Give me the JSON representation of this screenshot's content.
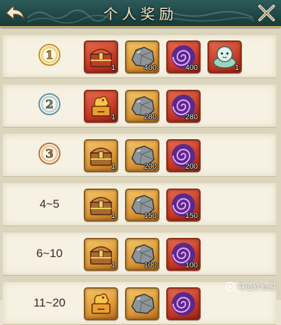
{
  "header": {
    "title": "个人奖励",
    "back_icon": "back-arrow-icon",
    "close_icon": "close-icon"
  },
  "colors": {
    "header_bg": "#1f4746",
    "row_bg": "#f6f1e2",
    "gold_frame": "#e09a36",
    "red_frame": "#c93b26"
  },
  "ranks": [
    {
      "rank_icon": "rank-1-medal-icon",
      "rank_label": "",
      "rewards": [
        {
          "icon": "red-treasure-chest-icon",
          "frame": "red",
          "qty": "1"
        },
        {
          "icon": "iron-ore-icon",
          "frame": "gold",
          "qty": "400"
        },
        {
          "icon": "purple-vortex-icon",
          "frame": "red",
          "qty": "400"
        },
        {
          "icon": "jade-pet-icon",
          "frame": "red",
          "qty": "1"
        }
      ]
    },
    {
      "rank_icon": "rank-2-medal-icon",
      "rank_label": "",
      "rewards": [
        {
          "icon": "golden-dragon-chest-icon",
          "frame": "red",
          "qty": "1"
        },
        {
          "icon": "iron-ore-icon",
          "frame": "gold",
          "qty": "280"
        },
        {
          "icon": "purple-vortex-icon",
          "frame": "red",
          "qty": "280"
        }
      ]
    },
    {
      "rank_icon": "rank-3-medal-icon",
      "rank_label": "",
      "rewards": [
        {
          "icon": "wooden-treasure-chest-icon",
          "frame": "gold",
          "qty": "1"
        },
        {
          "icon": "iron-ore-icon",
          "frame": "gold",
          "qty": "200"
        },
        {
          "icon": "purple-vortex-icon",
          "frame": "red",
          "qty": "200"
        }
      ]
    },
    {
      "rank_icon": "",
      "rank_label": "4~5",
      "rewards": [
        {
          "icon": "wooden-treasure-chest-icon",
          "frame": "gold",
          "qty": "1"
        },
        {
          "icon": "iron-ore-icon",
          "frame": "gold",
          "qty": "150"
        },
        {
          "icon": "purple-vortex-icon",
          "frame": "red",
          "qty": "150"
        }
      ]
    },
    {
      "rank_icon": "",
      "rank_label": "6~10",
      "rewards": [
        {
          "icon": "wooden-treasure-chest-icon",
          "frame": "gold",
          "qty": "1"
        },
        {
          "icon": "iron-ore-icon",
          "frame": "gold",
          "qty": "100"
        },
        {
          "icon": "purple-vortex-icon",
          "frame": "red",
          "qty": "100"
        }
      ]
    },
    {
      "rank_icon": "",
      "rank_label": "11~20",
      "rewards": [
        {
          "icon": "golden-dragon-chest-icon",
          "frame": "gold",
          "qty": ""
        },
        {
          "icon": "iron-ore-icon",
          "frame": "gold",
          "qty": ""
        },
        {
          "icon": "purple-vortex-icon",
          "frame": "red",
          "qty": ""
        }
      ]
    }
  ],
  "watermark": {
    "text": "寻道修仙阁",
    "icon": "wechat-channel-icon"
  }
}
